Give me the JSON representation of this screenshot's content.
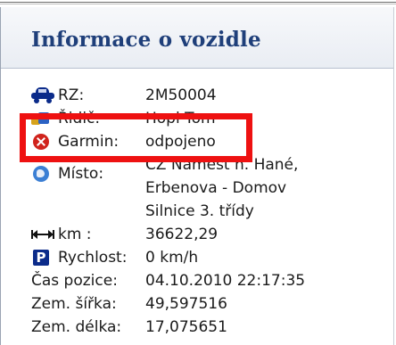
{
  "header": {
    "title": "Informace o vozidle"
  },
  "rows": {
    "rz": {
      "label": "RZ:",
      "value": "2M50004",
      "icon": "car-icon"
    },
    "ridic": {
      "label": "Řidič:",
      "value": "Hopl Tom",
      "icon": "driver-icon"
    },
    "garmin": {
      "label": "Garmin:",
      "value": "odpojeno",
      "icon": "error-icon"
    },
    "misto": {
      "label": "Místo:",
      "line1": "CZ Náměšť n. Hané,",
      "line2": "Erbenova - Domov",
      "line3": "Silnice 3. třídy",
      "icon": "globe-icon"
    },
    "km": {
      "label": "km :",
      "value": "36622,29",
      "icon": "distance-arrows-icon"
    },
    "rychlost": {
      "label": "Rychlost:",
      "value": "0 km/h",
      "icon": "parking-icon"
    },
    "cas_pozice": {
      "label": "Čas pozice:",
      "value": "04.10.2010 22:17:35"
    },
    "zem_sirka": {
      "label": "Zem. šířka:",
      "value": "49,597516"
    },
    "zem_delka": {
      "label": "Zem. délka:",
      "value": "17,075651"
    }
  },
  "colors": {
    "title": "#1f3f7a",
    "highlight": "#ee1111",
    "icon_blue": "#0b2b8a"
  }
}
